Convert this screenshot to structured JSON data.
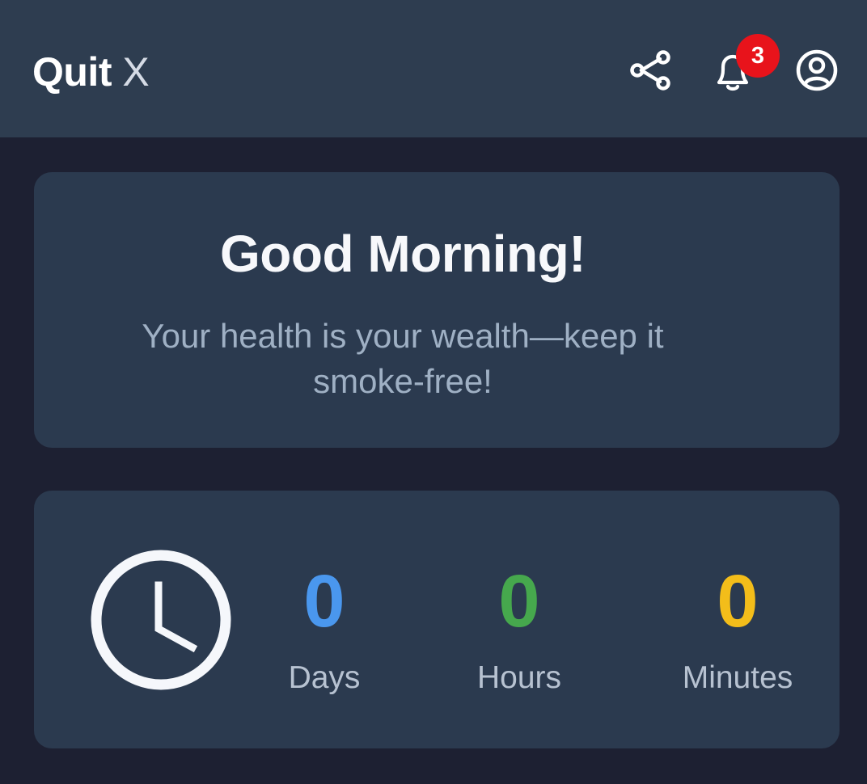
{
  "header": {
    "brand_primary": "Quit",
    "brand_secondary": "X",
    "notification_count": "3"
  },
  "icons": {
    "share": "share-icon",
    "notifications": "bell-icon",
    "profile": "user-circle-icon",
    "timer": "clock-icon"
  },
  "greeting": {
    "title": "Good Morning!",
    "subtitle": "Your health is your wealth—keep it smoke-free!"
  },
  "timer": {
    "days": {
      "value": "0",
      "label": "Days"
    },
    "hours": {
      "value": "0",
      "label": "Hours"
    },
    "minutes": {
      "value": "0",
      "label": "Minutes"
    }
  },
  "colors": {
    "background": "#1d2032",
    "header": "#2e3d50",
    "card": "#2b3a4f",
    "badge": "#e8131b",
    "days": "#4a97ee",
    "hours": "#46a84d",
    "minutes": "#f3bd1a"
  }
}
